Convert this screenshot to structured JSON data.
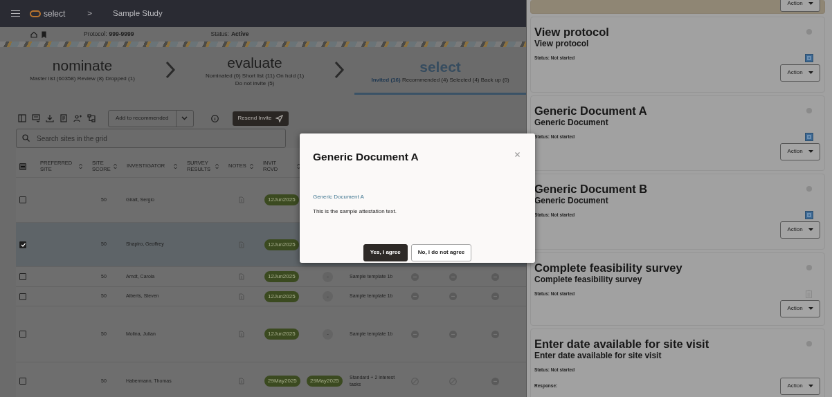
{
  "header": {
    "app_name": "select",
    "separator": ">",
    "study": "Sample Study"
  },
  "study_bar": {
    "protocol_label": "Protocol:",
    "protocol": "999-9999",
    "status_label": "Status:",
    "status": "Active"
  },
  "stages": [
    {
      "name": "nominate",
      "selected": false,
      "counts": [
        {
          "label": "Master list (60358)",
          "selected": false
        },
        {
          "label": "Review (8)",
          "selected": false
        },
        {
          "label": "Dropped (1)",
          "selected": false
        }
      ]
    },
    {
      "name": "evaluate",
      "selected": false,
      "counts": [
        {
          "label": "Nominated (0)",
          "selected": false
        },
        {
          "label": "Short list (11)",
          "selected": false
        },
        {
          "label": "On hold (1)",
          "selected": false
        },
        {
          "label": "Do not invite (5)",
          "selected": false
        }
      ]
    },
    {
      "name": "select",
      "selected": true,
      "counts": [
        {
          "label": "Invited (16)",
          "selected": true
        },
        {
          "label": "Recommended (4)",
          "selected": false
        },
        {
          "label": "Selected (4)",
          "selected": false
        },
        {
          "label": "Back up (0)",
          "selected": false
        }
      ]
    }
  ],
  "toolbar": {
    "split_button": "Add to recommended",
    "resend_button": "Resend Invite"
  },
  "search": {
    "placeholder": "Search sites in the grid"
  },
  "table": {
    "select_all_indeterminate": true,
    "columns": [
      "PREFERRED SITE",
      "SITE SCORE",
      "INVESTIGATOR",
      "SURVEY RESULTS",
      "NOTES",
      "INVIT RCVD"
    ],
    "rows": [
      {
        "checked": false,
        "selected": false,
        "site_score": "50",
        "investigator": "Giralt, Sergio",
        "invit_rcvd": "12Jun2025"
      },
      {
        "checked": true,
        "selected": true,
        "site_score": "50",
        "investigator": "Shapiro, Geoffrey",
        "invit_rcvd": "12Jun2025"
      },
      {
        "checked": false,
        "selected": false,
        "site_score": "50",
        "investigator": "Arndt, Carola",
        "invit_rcvd": "12Jun2025",
        "column_8": {
          "kind": "dot",
          "text": "-"
        },
        "column_9": "Sample template 1b",
        "statuses": [
          {
            "kind": "minus"
          },
          {
            "kind": "minus"
          },
          {
            "kind": "minus"
          }
        ]
      },
      {
        "checked": false,
        "selected": false,
        "site_score": "50",
        "investigator": "Alberts, Steven",
        "invit_rcvd": "12Jun2025",
        "column_8": {
          "kind": "dot",
          "text": "-"
        },
        "column_9": "Sample template 1b",
        "statuses": [
          {
            "kind": "minus"
          },
          {
            "kind": "minus"
          },
          {
            "kind": "minus"
          }
        ]
      },
      {
        "checked": false,
        "selected": false,
        "site_score": "50",
        "investigator": "Molina, Julian",
        "invit_rcvd": "12Jun2025",
        "column_8": {
          "kind": "dot",
          "text": "-"
        },
        "column_9": "Sample template 1b",
        "statuses": [
          {
            "kind": "minus"
          },
          {
            "kind": "minus"
          },
          {
            "kind": "minus"
          }
        ]
      },
      {
        "checked": false,
        "selected": false,
        "site_score": "50",
        "investigator": "Habermann, Thomas",
        "invit_rcvd": "29May2025",
        "column_8": {
          "kind": "pill",
          "text": "29May2025"
        },
        "column_9": "Standard + 2 interest tasks",
        "statuses": [
          {
            "kind": "slash"
          },
          {
            "kind": "slash"
          },
          {
            "kind": "minus"
          }
        ]
      }
    ]
  },
  "modal": {
    "title": "Generic Document A",
    "link": "Generic Document A",
    "text": "This is the sample attestation text.",
    "buttons": [
      {
        "label": "Yes, I agree",
        "kind": "primary"
      },
      {
        "label": "No, I do not agree",
        "kind": "secondary"
      }
    ]
  },
  "tasks": [
    {
      "selected": true,
      "action": "Action"
    },
    {
      "selected": false,
      "title": "View protocol",
      "subtitle": "View protocol",
      "status": "Status: Not started",
      "kind": "document",
      "action": "Action"
    },
    {
      "selected": false,
      "title": "Generic Document A",
      "subtitle": "Generic Document",
      "status": "Status: Not started",
      "kind": "document",
      "action": "Action"
    },
    {
      "selected": false,
      "title": "Generic Document B",
      "subtitle": "Generic Document",
      "status": "Status: Not started",
      "kind": "document",
      "action": "Action"
    },
    {
      "selected": false,
      "title": "Complete feasibility survey",
      "subtitle": "Complete feasibility survey",
      "status": "Status: Not started",
      "kind": "survey",
      "action": "Action"
    },
    {
      "selected": false,
      "title": "Enter date available for site visit",
      "subtitle": "Enter date available for site visit",
      "status": "Status: Not started",
      "response_label": "Response:",
      "action": "Action"
    }
  ]
}
